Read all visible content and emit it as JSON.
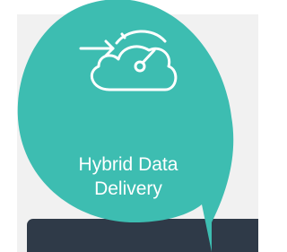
{
  "card": {
    "title_line1": "Hybrid Data",
    "title_line2": "Delivery",
    "icon": "cloud-speedometer-arrow-icon"
  },
  "colors": {
    "bubble": "#3dbdb1",
    "panel": "#f1f1f1",
    "bottom_bar": "#2f3a48",
    "text": "#ffffff"
  }
}
